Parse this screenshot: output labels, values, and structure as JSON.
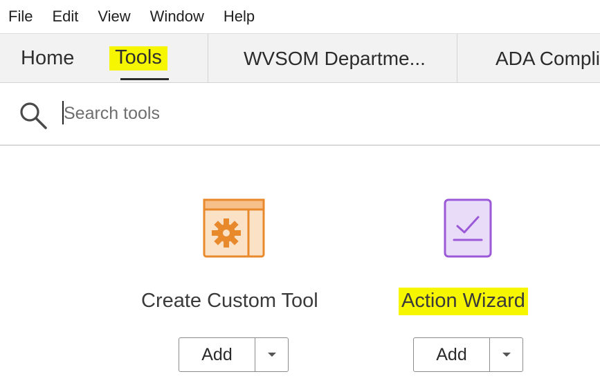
{
  "menubar": {
    "items": [
      {
        "label": "File"
      },
      {
        "label": "Edit"
      },
      {
        "label": "View"
      },
      {
        "label": "Window"
      },
      {
        "label": "Help"
      }
    ]
  },
  "tabs": {
    "home_label": "Home",
    "tools_label": "Tools",
    "documents": [
      {
        "label": "WVSOM Departme..."
      },
      {
        "label": "ADA Compli"
      }
    ],
    "active_tab": "Tools",
    "highlight_color": "#f6f600"
  },
  "search": {
    "placeholder": "Search tools",
    "value": "",
    "icon": "search-icon"
  },
  "tools": [
    {
      "name": "Create Custom Tool",
      "icon": "custom-tool-gear-icon",
      "icon_color": "#e8892c",
      "add_label": "Add"
    },
    {
      "name": "Action Wizard",
      "icon": "action-wizard-checklist-icon",
      "icon_color": "#9b59d8",
      "add_label": "Add",
      "highlighted": true
    }
  ]
}
